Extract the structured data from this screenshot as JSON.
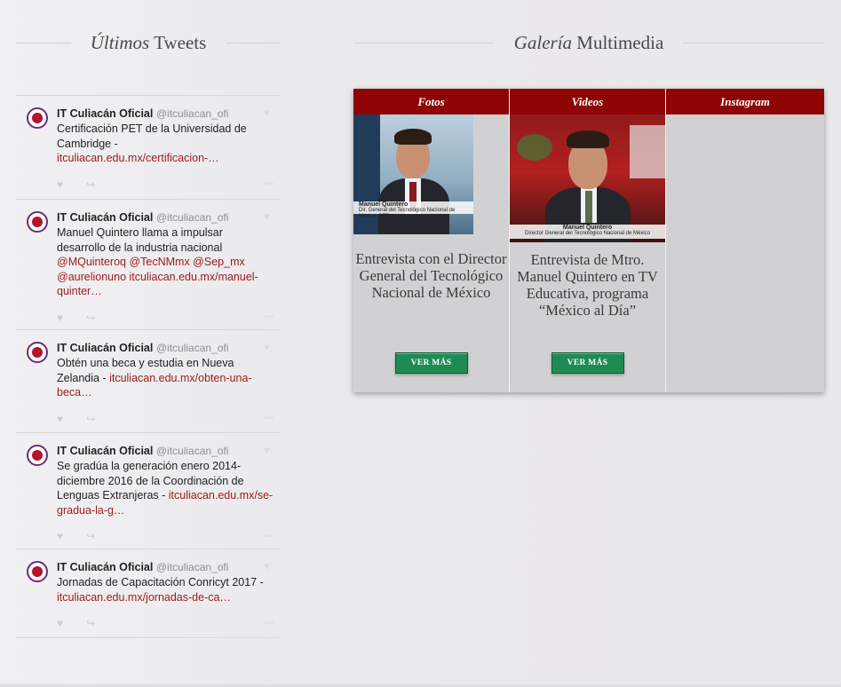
{
  "tweets_section": {
    "title_italic": "Últimos",
    "title_rest": " Tweets"
  },
  "gallery_section": {
    "title_italic": "Galería",
    "title_rest": " Multimedia"
  },
  "tweets": [
    {
      "name": "IT Culiacán Oficial",
      "handle": "@itculiacan_ofi",
      "text": "Certificación PET de la Universidad de Cambridge - ",
      "link": "itculiacan.edu.mx/certificacion-…"
    },
    {
      "name": "IT Culiacán Oficial",
      "handle": "@itculiacan_ofi",
      "text": "Manuel Quintero llama a impulsar desarrollo de la industria nacional ",
      "mentions": "@MQuinteroq @TecNMmx @Sep_mx @aurelionuno",
      "link": "itculiacan.edu.mx/manuel-quinter…"
    },
    {
      "name": "IT Culiacán Oficial",
      "handle": "@itculiacan_ofi",
      "text": "Obtén una beca y estudia en Nueva Zelandia - ",
      "link": "itculiacan.edu.mx/obten-una-beca…"
    },
    {
      "name": "IT Culiacán Oficial",
      "handle": "@itculiacan_ofi",
      "text": "Se gradúa la generación enero 2014-diciembre 2016 de la Coordinación de Lenguas Extranjeras - ",
      "link": "itculiacan.edu.mx/se-gradua-la-g…"
    },
    {
      "name": "IT Culiacán Oficial",
      "handle": "@itculiacan_ofi",
      "text": "Jornadas de Capacitación Conricyt 2017 - ",
      "link": "itculiacan.edu.mx/jornadas-de-ca…"
    }
  ],
  "gallery": {
    "tabs": [
      {
        "label": "Fotos"
      },
      {
        "label": "Videos"
      },
      {
        "label": "Instagram"
      }
    ],
    "items": [
      {
        "caption": "Entrevista con el Director General del Tecnológico Nacional de México",
        "thumb_name": "Manuel Quintero",
        "thumb_title": "Dir. General del Tecnológico Nacional de México, SEP",
        "button": "VER MÁS"
      },
      {
        "caption": "Entrevista de Mtro. Manuel Quintero en TV Educativa, programa “México al Día”",
        "thumb_name": "Manuel Quintero",
        "thumb_title": "Director General del Tecnológico Nacional de México",
        "button": "VER MÁS"
      }
    ]
  },
  "colors": {
    "tab_bg": "#8f0404",
    "link": "#9b1b1b",
    "button_bg": "#1f8b54",
    "gallery_bg": "#d1d1d3"
  }
}
